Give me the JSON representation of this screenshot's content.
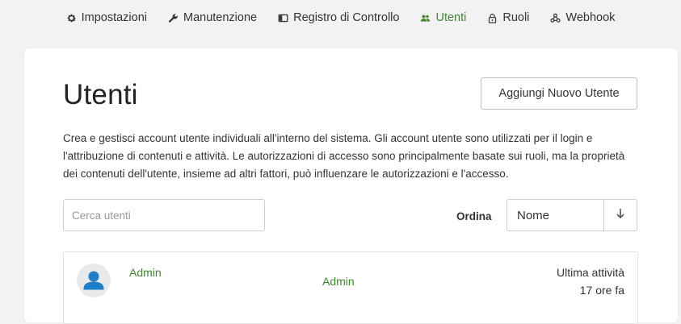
{
  "nav": {
    "items": [
      {
        "label": "Impostazioni",
        "icon": "gear-icon",
        "active": false
      },
      {
        "label": "Manutenzione",
        "icon": "wrench-icon",
        "active": false
      },
      {
        "label": "Registro di Controllo",
        "icon": "audit-log-icon",
        "active": false
      },
      {
        "label": "Utenti",
        "icon": "users-icon",
        "active": true
      },
      {
        "label": "Ruoli",
        "icon": "lock-icon",
        "active": false
      },
      {
        "label": "Webhook",
        "icon": "webhook-icon",
        "active": false
      }
    ]
  },
  "page": {
    "title": "Utenti",
    "add_button_label": "Aggiungi Nuovo Utente",
    "description": "Crea e gestisci account utente individuali all'interno del sistema. Gli account utente sono utilizzati per il login e l'attribuzione di contenuti e attività. Le autorizzazioni di accesso sono principalmente basate sui ruoli, ma la proprietà dei contenuti dell'utente, insieme ad altri fattori, può influenzare le autorizzazioni e l'accesso."
  },
  "search": {
    "placeholder": "Cerca utenti",
    "value": ""
  },
  "sort": {
    "label": "Ordina",
    "selected": "Nome",
    "direction_icon": "arrow-down-icon"
  },
  "users": [
    {
      "name": "Admin",
      "role": "Admin",
      "activity_label": "Ultima attività",
      "activity_time": "17 ore fa"
    }
  ],
  "colors": {
    "accent": "#3f8a2c",
    "background": "#f2f2f2",
    "card": "#ffffff",
    "avatar_icon": "#1e7fc8"
  }
}
